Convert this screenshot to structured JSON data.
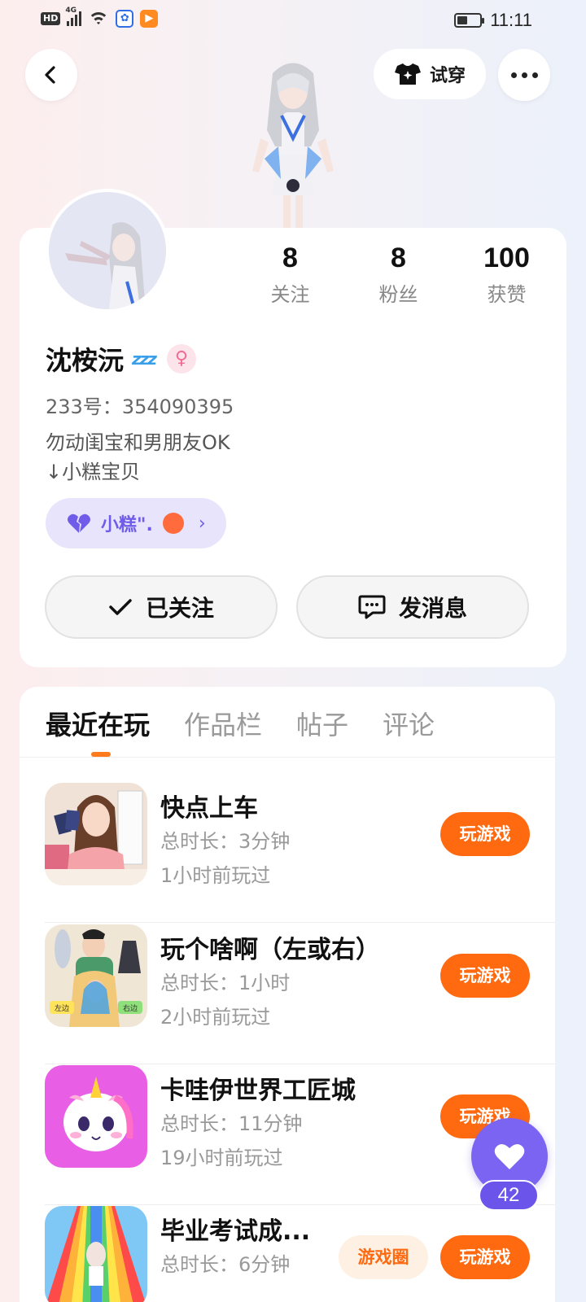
{
  "status_bar": {
    "hd_label": "HD",
    "network_label": "4G",
    "time": "11:11"
  },
  "header": {
    "try_on_label": "试穿"
  },
  "profile": {
    "stats": [
      {
        "value": "8",
        "label": "关注"
      },
      {
        "value": "8",
        "label": "粉丝"
      },
      {
        "value": "100",
        "label": "获赞"
      }
    ],
    "name": "沈桉沅",
    "status_icon_text": "zzz",
    "gender_symbol": "♀",
    "uid": "233号：354090395",
    "bio_lines": [
      "勿动闺宝和男朋友OK",
      "↓小糕宝贝"
    ],
    "cp_tag": {
      "name": "小糕\".",
      "arrow": "›"
    },
    "follow_label": "已关注",
    "message_label": "发消息"
  },
  "tabs": [
    {
      "label": "最近在玩",
      "active": true
    },
    {
      "label": "作品栏",
      "active": false
    },
    {
      "label": "帖子",
      "active": false
    },
    {
      "label": "评论",
      "active": false
    }
  ],
  "games": [
    {
      "title": "快点上车",
      "duration": "总时长：3分钟",
      "last_played": "1小时前玩过",
      "play_label": "玩游戏"
    },
    {
      "title": "玩个啥啊（左或右）",
      "duration": "总时长：1小时",
      "last_played": "2小时前玩过",
      "play_label": "玩游戏",
      "icon_tags": [
        "左边",
        "右边"
      ]
    },
    {
      "title": "卡哇伊世界工匠城",
      "duration": "总时长：11分钟",
      "last_played": "19小时前玩过",
      "play_label": "玩游戏"
    },
    {
      "title": "毕业考试成...",
      "duration": "总时长：6分钟",
      "last_played": "",
      "play_label": "玩游戏",
      "circle_label": "游戏圈"
    }
  ],
  "like_fab": {
    "count": "42"
  },
  "colors": {
    "accent_orange": "#ff6a10",
    "accent_purple": "#7b64f2",
    "cp_tag_bg": "#e7e4fc"
  }
}
